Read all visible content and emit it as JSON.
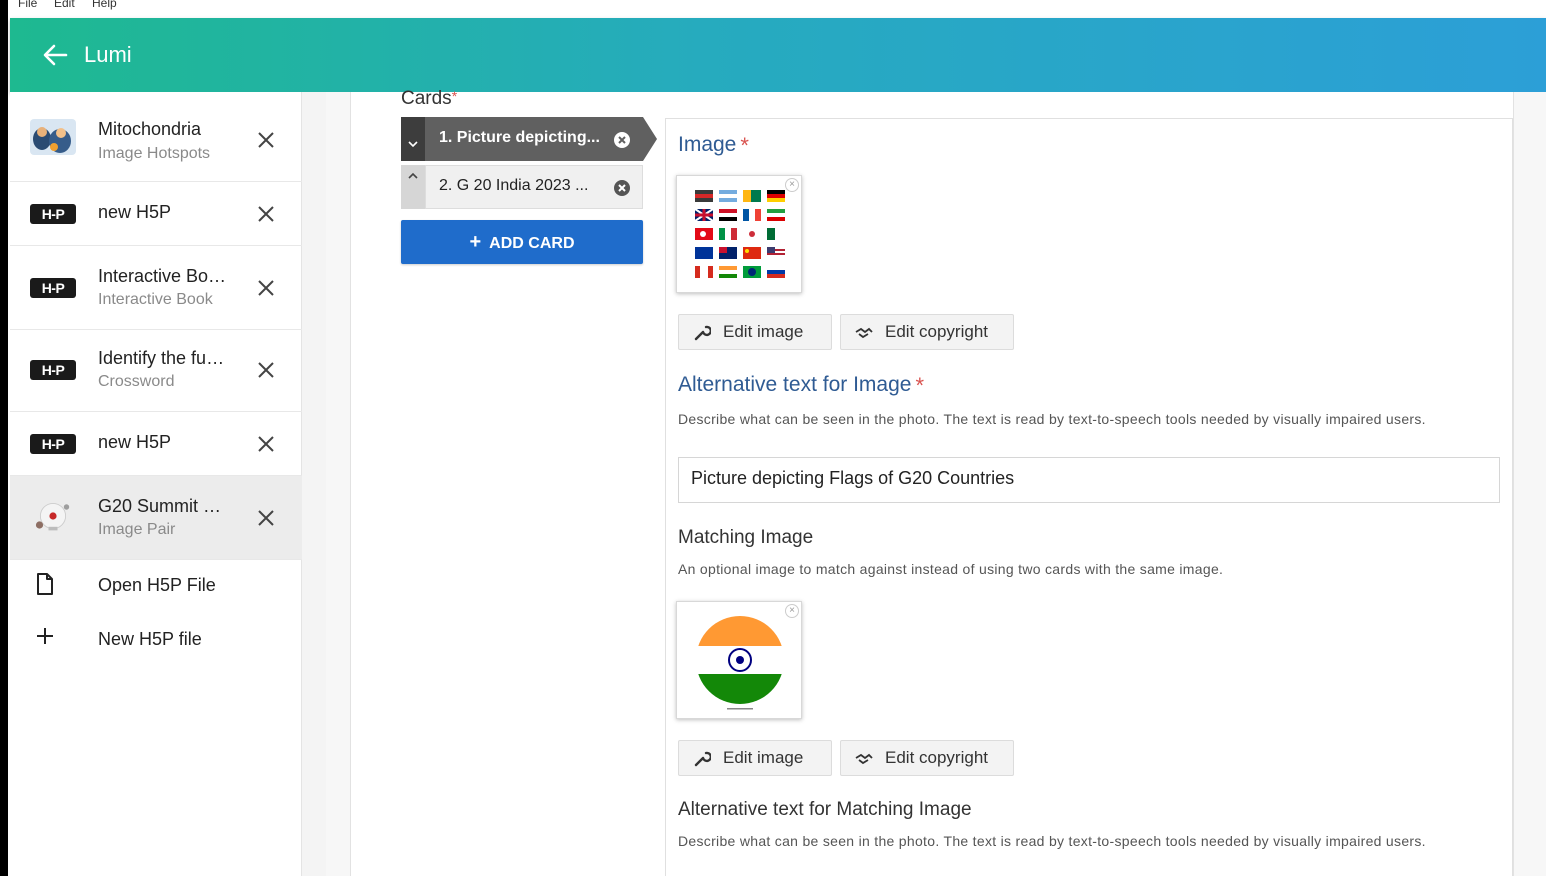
{
  "menubar": {
    "items": [
      "File",
      "Edit",
      "Help"
    ]
  },
  "app": {
    "title": "Lumi"
  },
  "sidebar": {
    "items": [
      {
        "title": "Mitochondria",
        "subtitle": "Image Hotspots",
        "icon": "mitochondria-thumbnail"
      },
      {
        "title": "new H5P",
        "subtitle": "",
        "icon": "h5p-logo-icon"
      },
      {
        "title": "Interactive Bo…",
        "subtitle": "Interactive Book",
        "icon": "h5p-logo-icon"
      },
      {
        "title": "Identify the fu…",
        "subtitle": "Crossword",
        "icon": "h5p-logo-icon"
      },
      {
        "title": "new H5P",
        "subtitle": "",
        "icon": "h5p-logo-icon"
      },
      {
        "title": "G20 Summit …",
        "subtitle": "Image Pair",
        "icon": "g20-thumbnail",
        "active": true
      }
    ],
    "h5p_badge": "H-P",
    "open_file": "Open H5P File",
    "new_file": "New H5P file"
  },
  "editor": {
    "cards_label": "Cards",
    "required_mark": "*",
    "cards": [
      {
        "label": "1. Picture depicting...",
        "active": true
      },
      {
        "label": "2. G 20 India 2023 ...",
        "active": false
      }
    ],
    "add_card": "ADD CARD",
    "image_title": "Image",
    "edit_image": "Edit image",
    "edit_copyright": "Edit copyright",
    "alt_title": "Alternative text for Image",
    "alt_desc": "Describe what can be seen in the photo. The text is read by text-to-speech tools needed by visually impaired users.",
    "alt_value": "Picture depicting Flags of G20 Countries",
    "matching_title": "Matching Image",
    "matching_desc": "An optional image to match against instead of using two cards with the same image.",
    "alt_matching_title": "Alternative text for Matching Image",
    "alt_matching_desc": "Describe what can be seen in the photo. The text is read by text-to-speech tools needed by visually impaired users."
  },
  "colors": {
    "appbar_start": "#1eb990",
    "appbar_end": "#2c9fd7",
    "add_card_button": "#1f6ccb",
    "field_title": "#2f5b93",
    "required": "#d9534f"
  }
}
